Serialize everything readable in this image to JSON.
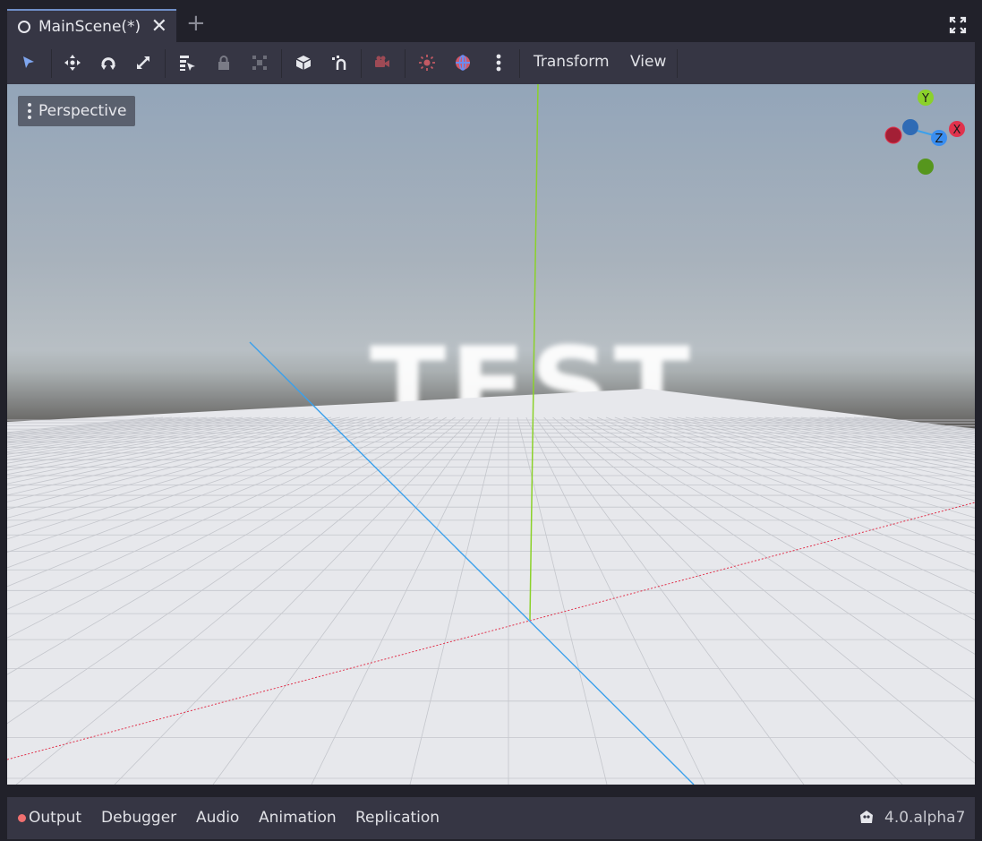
{
  "tabs": {
    "main_label": "MainScene(*)",
    "close_symbol": "✕",
    "add_symbol": "+"
  },
  "toolbar": {
    "icons": [
      "select-icon",
      "move-icon",
      "rotate-icon",
      "scale-icon",
      "list-select-icon",
      "lock-icon",
      "group-icon",
      "mesh-cube-icon",
      "snap-icon",
      "camera-icon",
      "sun-icon",
      "environment-icon",
      "more-icon"
    ],
    "transform_label": "Transform",
    "view_label": "View"
  },
  "viewport": {
    "perspective_label": "Perspective",
    "scene_text": "TEST",
    "gizmo": {
      "y_label": "Y",
      "x_label": "X",
      "z_label": "Z"
    },
    "axis_colors": {
      "x": "#e0334d",
      "y": "#8bd12a",
      "z": "#3aa0ec"
    }
  },
  "bottom": {
    "output": "Output",
    "debugger": "Debugger",
    "audio": "Audio",
    "animation": "Animation",
    "replication": "Replication",
    "version": "4.0.alpha7"
  }
}
